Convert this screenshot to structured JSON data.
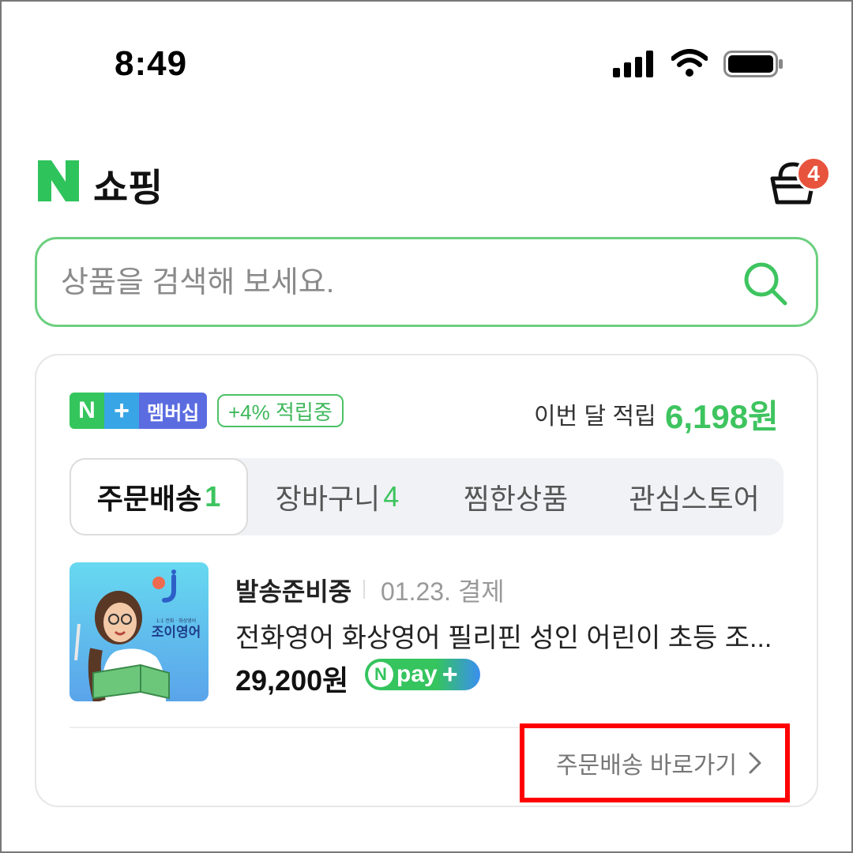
{
  "status_bar": {
    "time": "8:49",
    "icons": [
      "cellular-signal-icon",
      "wifi-icon",
      "battery-icon"
    ]
  },
  "header": {
    "logo": "N",
    "title": "쇼핑",
    "cart_count": "4"
  },
  "search": {
    "placeholder": "상품을 검색해 보세요."
  },
  "membership": {
    "n": "N",
    "plus": "+",
    "label": "멤버십",
    "reward_badge": "+4% 적립중",
    "month_label": "이번 달 적립",
    "month_amount": "6,198원"
  },
  "tabs": [
    {
      "label": "주문배송",
      "count": "1",
      "active": true
    },
    {
      "label": "장바구니",
      "count": "4",
      "active": false
    },
    {
      "label": "찜한상품",
      "count": "",
      "active": false
    },
    {
      "label": "관심스토어",
      "count": "",
      "active": false
    }
  ],
  "order": {
    "status": "발송준비중",
    "date": "01.23. 결제",
    "product_name": "전화영어 화상영어 필리핀 성인 어린이 초등 조...",
    "price": "29,200원",
    "thumb_text": "조이영어",
    "thumb_small": "1:1 전화 · 화상영어",
    "npay": {
      "n": "N",
      "text": "pay",
      "plus": "+"
    }
  },
  "shortcut": {
    "label": "주문배송 바로가기"
  },
  "colors": {
    "brand_green": "#3ec45f",
    "highlight_red": "#ff0000",
    "badge_red": "#e8533d"
  }
}
